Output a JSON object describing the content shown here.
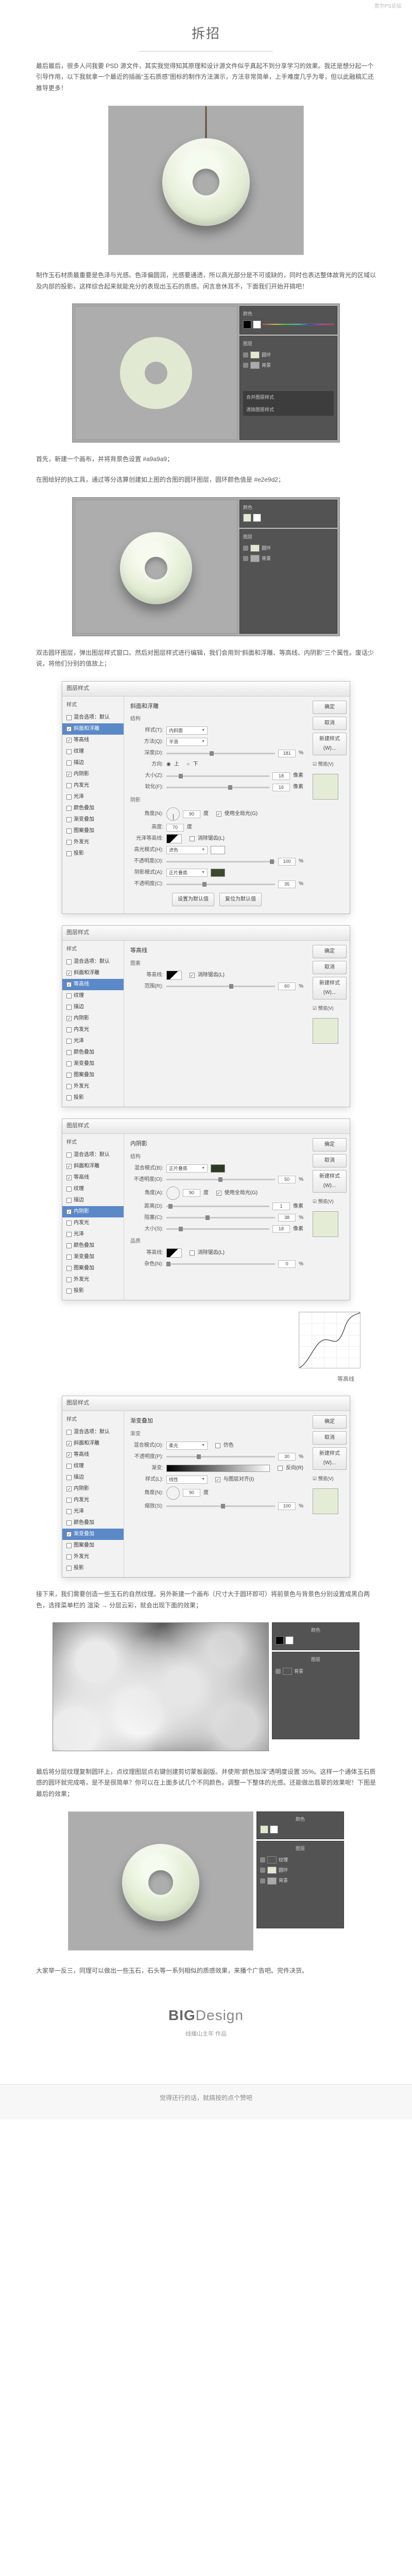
{
  "watermark": "贵尔PS论坛",
  "title": "拆招",
  "intro": "最后最后，很多人问我要 PSD 源文件，其实我觉得知其原理和设计源文件似乎真起不到分享学习的效果。我还是想分起一个引导作用，以下我就拿一个最近的插画“玉石质感”图标的制作方法演示，方法非常简单，上手难度几乎为零，但以此融稿汇还推导更多！",
  "p1": "制作玉石材质最重要是色泽与光感。色泽偏圆润，光感要通透，所以高光部分是不可或缺的，同时也表达整体故背光的区域以及内部的投影，这样综合起来就能充分的表现出玉石的质感。闲言息休耳不，下面我们开始开搞吧！",
  "p2": "首先，新建一个画布，并将背景色设置 #a9a9a9；",
  "p3": "在图绘好的执工具，通过等分选算创建如上图的合图的圆环图层，圆环颜色值是 #e2e9d2；",
  "p4": "双击圆环图层，弹出图层样式窗口。然后对图层样式进行编辑，我们会用到“斜面和浮雕、等高线、内阴影”三个属性。废话少说，将他们分别的值放上；",
  "right_label_tall": "等高线",
  "p5": "接下来，我们需要创造一些玉石的自然纹理。另外新建一个画布（尺寸大于圆环即可）将前景色与背景色分别设置成黑白两色，选择菜单栏的 渲染 → 分层云彩，就会出现下面的效果；",
  "p6": "最后将分层纹理复制圆环上，点纹理图层点右键创建剪切蒙板副版。并使用“颜色加深”透明度设置 35%。这样一个通体玉石质感的圆环就完成咯，是不是很简单？你可以在上面多试几个不同颜色，调整一下整体的光感。还能做出翡翠的效果呢！下图是最后的效果；",
  "p7": "大家举一反三，同理可以做出一些玉石，石头等一系列相似的质感效果，来播个广告吧。完件决货。",
  "brand_big_bold": "BIG",
  "brand_big_light": "Design",
  "brand_sub": "线播山主年 作品",
  "bottom": "觉得还行的话，就搞按的点个赞吧",
  "ps": {
    "color_hdr": "颜色",
    "layers_hdr": "图层",
    "layer_ring": "圆环",
    "layer_bg": "背景",
    "action_merge": "合并图层样式",
    "action_clear": "清除图层样式"
  },
  "ls": {
    "title": "图层样式",
    "left_title": "样式",
    "items": [
      "混合选项：默认",
      "斜面和浮雕",
      "等高线",
      "纹理",
      "描边",
      "内阴影",
      "内发光",
      "光泽",
      "颜色叠加",
      "渐变叠加",
      "图案叠加",
      "外发光",
      "投影"
    ],
    "btn_ok": "确定",
    "btn_cancel": "取消",
    "btn_new": "新建样式(W)...",
    "btn_preview": "☑ 预览(V)",
    "bevel": {
      "section": "斜面和浮雕",
      "struct": "结构",
      "style_l": "样式(T):",
      "style_v": "内斜面",
      "method_l": "方法(Q):",
      "method_v": "平滑",
      "depth_l": "深度(D):",
      "depth_v": "181",
      "pct": "%",
      "dir_l": "方向:",
      "dir_up": "上",
      "dir_down": "下",
      "size_l": "大小(Z):",
      "size_v": "18",
      "px": "像素",
      "soft_l": "软化(F):",
      "soft_v": "16",
      "shade": "阴影",
      "angle_l": "角度(N):",
      "angle_v": "90",
      "deg": "度",
      "global": "使用全局光(G)",
      "alt_l": "高度:",
      "alt_v": "70",
      "gloss_l": "光泽等高线:",
      "anti": "消除锯齿(L)",
      "hmode_l": "高光模式(H):",
      "hmode_v": "滤色",
      "hopac_l": "不透明度(O):",
      "hopac_v": "100",
      "smode_l": "阴影模式(A):",
      "smode_v": "正片叠底",
      "sopac_l": "不透明度(C):",
      "sopac_v": "35",
      "reset": "设置为默认值",
      "make_default": "复位为默认值"
    },
    "contour": {
      "section": "等高线",
      "elem": "图素",
      "contour_l": "等高线:",
      "anti": "消除锯齿(L)",
      "range_l": "范围(R):",
      "range_v": "60",
      "pct": "%"
    },
    "inner": {
      "section": "内阴影",
      "struct": "结构",
      "blend_l": "混合模式(B):",
      "blend_v": "正片叠底",
      "opac_l": "不透明度(O):",
      "opac_v": "50",
      "pct": "%",
      "angle_l": "角度(A):",
      "angle_v": "90",
      "deg": "度",
      "global": "使用全局光(G)",
      "dist_l": "距离(D):",
      "dist_v": "1",
      "px": "像素",
      "choke_l": "阻塞(C):",
      "choke_v": "38",
      "size_l": "大小(S):",
      "size_v": "18",
      "quality": "品质",
      "contour_l": "等高线:",
      "anti": "消除锯齿(L)",
      "noise_l": "杂色(N):",
      "noise_v": "0"
    },
    "grad": {
      "section": "渐变叠加",
      "grad": "渐变",
      "blend_l": "混合模式(O):",
      "blend_v": "柔光",
      "dither": "仿色",
      "opac_l": "不透明度(P):",
      "opac_v": "30",
      "pct": "%",
      "grad_l": "渐变:",
      "reverse": "反向(R)",
      "style_l": "样式(L):",
      "style_v": "线性",
      "align": "与图层对齐(I)",
      "angle_l": "角度(N):",
      "angle_v": "90",
      "deg": "度",
      "scale_l": "缩放(S):",
      "scale_v": "100"
    }
  }
}
